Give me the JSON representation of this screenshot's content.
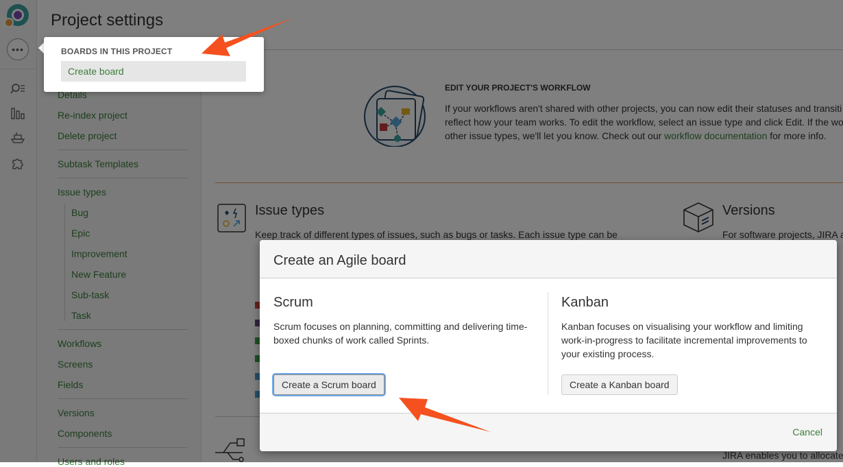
{
  "page": {
    "title": "Project settings"
  },
  "rail": {
    "icons": [
      "project-avatar",
      "more-icon",
      "search-icon",
      "reports-icon",
      "ship-icon",
      "addons-icon"
    ],
    "more_label": "•••"
  },
  "sidebar": {
    "items": [
      {
        "label": "Details"
      },
      {
        "label": "Re-index project"
      },
      {
        "label": "Delete project"
      },
      {
        "label": "Subtask Templates"
      },
      {
        "label": "Issue types"
      },
      {
        "label": "Bug"
      },
      {
        "label": "Epic"
      },
      {
        "label": "Improvement"
      },
      {
        "label": "New Feature"
      },
      {
        "label": "Sub-task"
      },
      {
        "label": "Task"
      },
      {
        "label": "Workflows"
      },
      {
        "label": "Screens"
      },
      {
        "label": "Fields"
      },
      {
        "label": "Versions"
      },
      {
        "label": "Components"
      },
      {
        "label": "Users and roles"
      }
    ]
  },
  "workflow_panel": {
    "heading": "EDIT YOUR PROJECT'S WORKFLOW",
    "line1": "If your workflows aren't shared with other projects, you can now edit their statuses and transiti",
    "line2": "reflect how your team works. To edit the workflow, select an issue type and click Edit. If the wo",
    "line3_pre": "other issue types, we'll let you know. Check out our ",
    "line3_link": "workflow documentation",
    "line3_post": " for more info."
  },
  "issue_types_panel": {
    "title": "Issue types",
    "text": "Keep track of different types of issues, such as bugs or tasks. Each issue type can be"
  },
  "versions_panel": {
    "title": "Versions",
    "text": "For software projects, JIRA a",
    "text2": "JIRA enables you to allocate"
  },
  "dropdown": {
    "heading": "BOARDS IN THIS PROJECT",
    "item": "Create board"
  },
  "dialog": {
    "title": "Create an Agile board",
    "scrum": {
      "title": "Scrum",
      "desc1": "Scrum focuses on planning, committing and delivering time-",
      "desc2": "boxed chunks of work called Sprints.",
      "button": "Create a Scrum board"
    },
    "kanban": {
      "title": "Kanban",
      "desc1": "Kanban focuses on visualising your workflow and limiting",
      "desc2": "work-in-progress to facilitate incremental improvements to",
      "desc3": "your existing process.",
      "button": "Create a Kanban board"
    },
    "cancel": "Cancel"
  },
  "colors": {
    "link": "#3b7d3b",
    "annotation_arrow": "#f4511e",
    "focus_ring": "#6fa8e8"
  }
}
